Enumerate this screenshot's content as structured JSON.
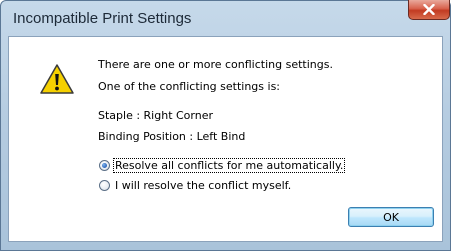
{
  "window": {
    "title": "Incompatible Print Settings"
  },
  "icons": {
    "warning": "warning-icon",
    "close": "close-icon"
  },
  "message": {
    "line1": "There are one or more conflicting settings.",
    "line2": "One of the conflicting settings is:",
    "setting1": "Staple : Right Corner",
    "setting2": "Binding Position : Left Bind"
  },
  "options": [
    {
      "label": "Resolve all conflicts for me automatically.",
      "selected": true
    },
    {
      "label": "I will resolve the conflict myself.",
      "selected": false
    }
  ],
  "buttons": {
    "ok": "OK"
  },
  "colors": {
    "warning_fill": "#f5d000",
    "close_red": "#c23b22",
    "selected_dot": "#2a63b8"
  }
}
